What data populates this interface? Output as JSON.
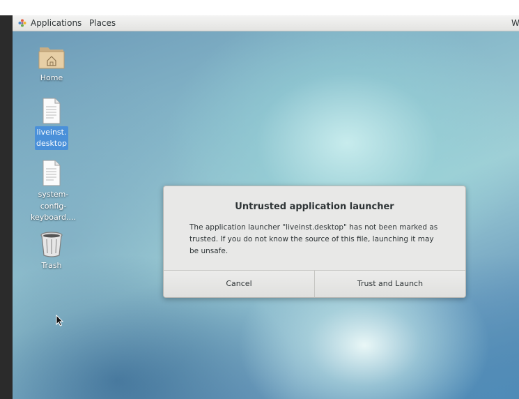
{
  "panel": {
    "applications_label": "Applications",
    "places_label": "Places",
    "right_truncated_text": "W"
  },
  "desktop_icons": [
    {
      "label": "Home",
      "icon": "home-folder-icon",
      "selected": false
    },
    {
      "label": "liveinst.\ndesktop",
      "icon": "text-file-icon",
      "selected": true
    },
    {
      "label": "system-\nconfig-\nkeyboard....",
      "icon": "text-file-icon",
      "selected": false
    },
    {
      "label": "Trash",
      "icon": "trash-icon",
      "selected": false
    }
  ],
  "dialog": {
    "title": "Untrusted application launcher",
    "message": "The application launcher \"liveinst.desktop\" has not been marked as trusted. If you do not know the source of this file, launching it may be unsafe.",
    "cancel_label": "Cancel",
    "trust_label": "Trust and Launch"
  },
  "colors": {
    "selection": "#4a90d9",
    "panel": "#ececeb",
    "dialog": "#e8e8e7"
  }
}
